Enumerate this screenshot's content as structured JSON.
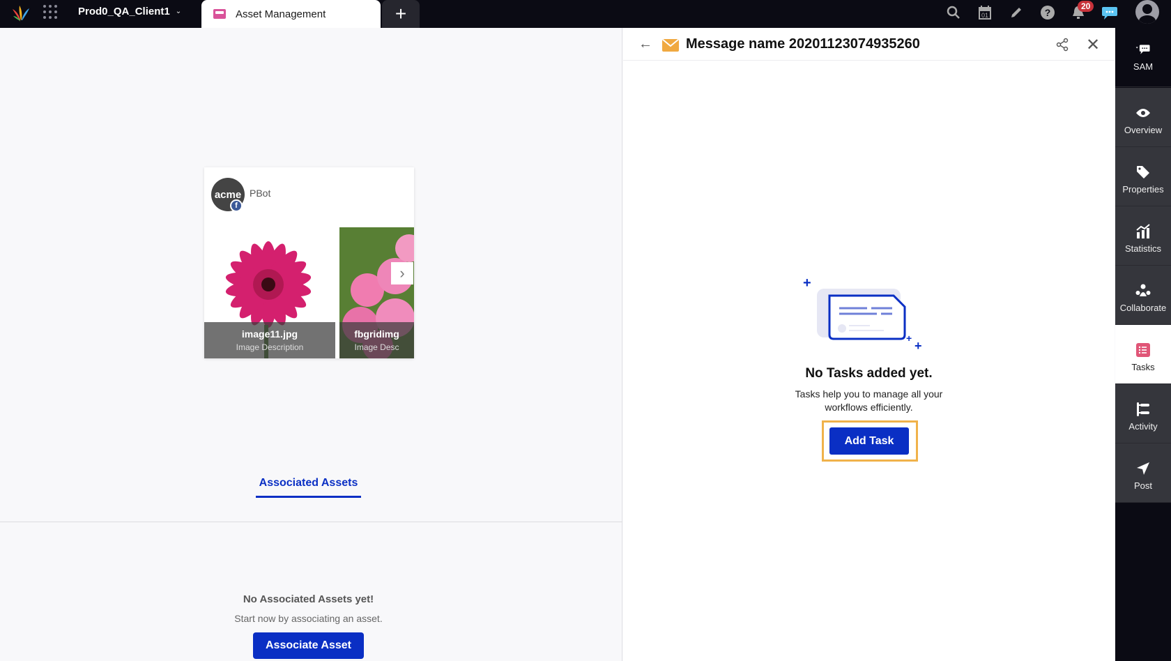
{
  "topbar": {
    "client_name": "Prod0_QA_Client1",
    "tab_label": "Asset Management",
    "new_tab_symbol": "+",
    "notification_count": "20",
    "icons": [
      "search-icon",
      "calendar-icon",
      "edit-icon",
      "help-icon",
      "bell-icon",
      "chat-icon",
      "user-avatar-icon"
    ],
    "calendar_day": "01"
  },
  "post_card": {
    "account_initials": "acme",
    "account_name": "PBot",
    "network_badge": "f",
    "images": [
      {
        "title": "image11.jpg",
        "description": "Image Description"
      },
      {
        "title": "fbgridimg",
        "description": "Image Desc"
      }
    ]
  },
  "left": {
    "tab_label": "Associated Assets",
    "empty_title": "No Associated Assets yet!",
    "empty_sub": "Start now by associating an asset.",
    "associate_button": "Associate Asset"
  },
  "right_panel": {
    "title": "Message name 20201123074935260",
    "empty_title": "No Tasks added yet.",
    "empty_line1": "Tasks help you to manage all your",
    "empty_line2": "workflows efficiently.",
    "add_task_button": "Add Task"
  },
  "sidebar": {
    "items": [
      {
        "label": "SAM",
        "icon": "chat-icon"
      },
      {
        "label": "Overview",
        "icon": "eye-icon"
      },
      {
        "label": "Properties",
        "icon": "tag-icon"
      },
      {
        "label": "Statistics",
        "icon": "chart-icon"
      },
      {
        "label": "Collaborate",
        "icon": "people-icon"
      },
      {
        "label": "Tasks",
        "icon": "list-icon",
        "active": true
      },
      {
        "label": "Activity",
        "icon": "activity-icon"
      },
      {
        "label": "Post",
        "icon": "send-icon"
      }
    ]
  },
  "colors": {
    "primary": "#0a2fc4",
    "topbar": "#0b0b14",
    "highlight": "#f0b24a",
    "badge": "#c8323a",
    "tasks_icon": "#e05577"
  }
}
